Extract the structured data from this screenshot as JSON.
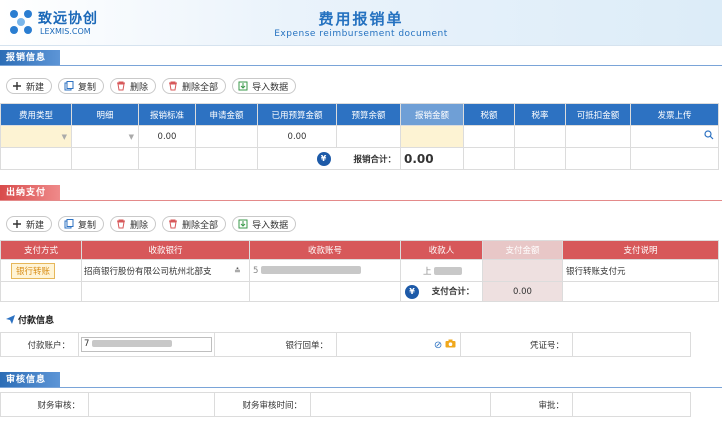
{
  "header": {
    "logo_cn": "致远协创",
    "logo_en": "LEXMIS.COM",
    "title_cn": "费用报销单",
    "title_en": "Expense reimbursement document"
  },
  "colors": {
    "primary": "#2d72c2",
    "danger": "#d7585a",
    "accent_yellow": "#fdf3d3"
  },
  "reimburse": {
    "section_title": "报销信息",
    "toolbar": {
      "new": "新建",
      "copy": "复制",
      "delete": "删除",
      "delete_all": "删除全部",
      "import": "导入数据"
    },
    "columns": [
      "费用类型",
      "明细",
      "报销标准",
      "申请金额",
      "已用预算金额",
      "预算余额",
      "报销金额",
      "税额",
      "税率",
      "可抵扣金额",
      "发票上传"
    ],
    "row": {
      "standard": "0.00",
      "used_budget": "0.00"
    },
    "total_label": "报销合计：",
    "total_value": "0.00",
    "yen": "¥"
  },
  "payment": {
    "section_title": "出纳支付",
    "toolbar": {
      "new": "新建",
      "copy": "复制",
      "delete": "删除",
      "delete_all": "删除全部",
      "import": "导入数据"
    },
    "columns": [
      "支付方式",
      "收款银行",
      "收款账号",
      "收款人",
      "支付金额",
      "支付说明"
    ],
    "row": {
      "method": "银行转账",
      "bank": "招商银行股份有限公司杭州北部支",
      "account_prefix": "5",
      "payee_prefix": "上",
      "note": "银行转账支付元"
    },
    "total_label": "支付合计：",
    "total_value": "0.00",
    "yen": "¥"
  },
  "pay_info": {
    "title": "付款信息",
    "account_label": "付款账户：",
    "account_value": "7",
    "receipt_label": "银行回单：",
    "voucher_label": "凭证号："
  },
  "audit": {
    "section_title": "审核信息",
    "finance_label": "财务审核：",
    "time_label": "财务审核时间：",
    "approve_label": "审批："
  }
}
